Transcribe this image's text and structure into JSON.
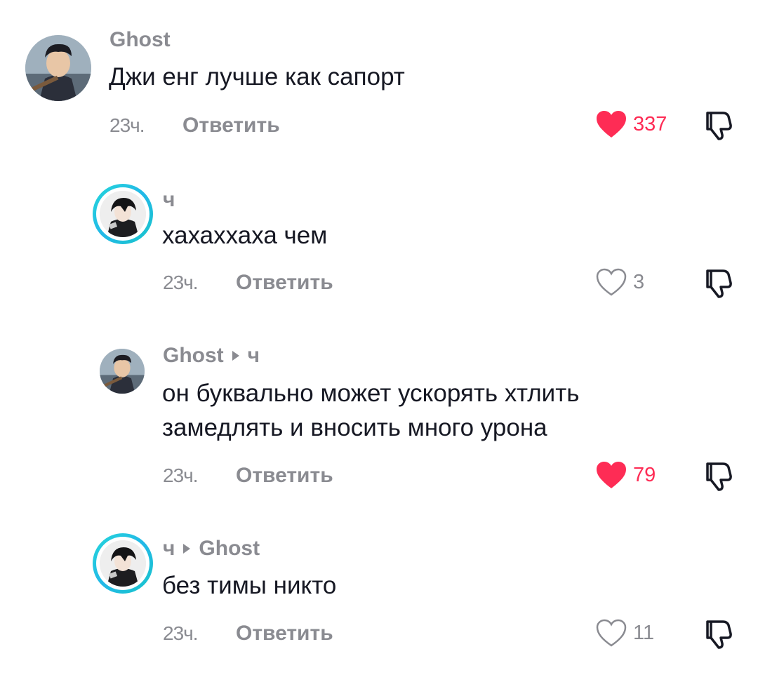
{
  "comments": [
    {
      "user": "Ghost",
      "reply_to": "",
      "text": "Джи енг лучше как сапорт",
      "time": "23ч.",
      "reply_label": "Ответить",
      "likes": "337",
      "liked": true
    },
    {
      "user": "ч",
      "reply_to": "",
      "text": "хахаххаха чем",
      "time": "23ч.",
      "reply_label": "Ответить",
      "likes": "3",
      "liked": false
    },
    {
      "user": "Ghost",
      "reply_to": "ч",
      "text_line1": "он буквально может ускорять хтлить",
      "text_line2": "замедлять и вносить много урона",
      "time": "23ч.",
      "reply_label": "Ответить",
      "likes": "79",
      "liked": true
    },
    {
      "user": "ч",
      "reply_to": "Ghost",
      "text": "без тимы никто",
      "time": "23ч.",
      "reply_label": "Ответить",
      "likes": "11",
      "liked": false
    }
  ],
  "icons": {
    "heart": "heart-icon",
    "dislike": "thumbs-down-icon",
    "reply_arrow": "caret-right-icon"
  },
  "colors": {
    "like_active": "#fe2c55",
    "muted_text": "#8a8b91",
    "primary_text": "#161823",
    "story_ring": "#22c4dc"
  }
}
